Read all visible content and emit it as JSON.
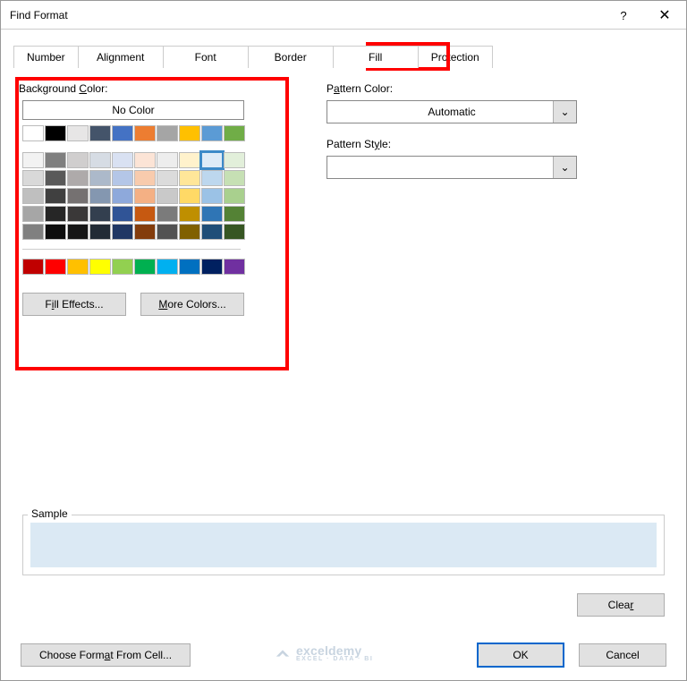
{
  "title": "Find Format",
  "help_glyph": "?",
  "close_glyph": "✕",
  "tabs": {
    "number": "Number",
    "alignment": "Alignment",
    "font": "Font",
    "border": "Border",
    "fill": "Fill",
    "protection": "Protection"
  },
  "left": {
    "bg_label_pre": "Background ",
    "bg_label_u": "C",
    "bg_label_post": "olor:",
    "no_color": "No Color",
    "fill_effects_u": "I",
    "fill_effects_pre": "Fill Effects...",
    "more_colors_u": "M",
    "more_colors_post": "ore Colors..."
  },
  "right": {
    "pattern_color_pre": "P",
    "pattern_color_u": "a",
    "pattern_color_post": "ttern Color:",
    "automatic": "Automatic",
    "pattern_style_pre": "Pattern St",
    "pattern_style_u": "y",
    "pattern_style_post": "le:"
  },
  "sample": "Sample",
  "clear_u": "R",
  "clear_post": "Clea",
  "choose_format_pre": "Choose Form",
  "choose_format_u": "a",
  "choose_format_post": "t From Cell...",
  "ok": "OK",
  "cancel": "Cancel",
  "watermark": "exceldemy",
  "watermark_sub": "EXCEL · DATA · BI",
  "dropdown_glyph": "⌄",
  "colors": {
    "theme_row": [
      "#ffffff",
      "#000000",
      "#e7e6e6",
      "#44546a",
      "#4472c4",
      "#ed7d31",
      "#a5a5a5",
      "#ffc000",
      "#5b9bd5",
      "#70ad47"
    ],
    "grid": [
      [
        "#f2f2f2",
        "#7f7f7f",
        "#d0cece",
        "#d6dce4",
        "#d9e1f2",
        "#fce4d6",
        "#ededed",
        "#fff2cc",
        "#ddebf7",
        "#e2efda"
      ],
      [
        "#d9d9d9",
        "#595959",
        "#aeaaaa",
        "#acb9ca",
        "#b4c6e7",
        "#f8cbad",
        "#dbdbdb",
        "#ffe699",
        "#bdd7ee",
        "#c6e0b4"
      ],
      [
        "#bfbfbf",
        "#404040",
        "#757171",
        "#8497b0",
        "#8ea9db",
        "#f4b084",
        "#c9c9c9",
        "#ffd966",
        "#9bc2e6",
        "#a9d08e"
      ],
      [
        "#a6a6a6",
        "#262626",
        "#3a3838",
        "#333f4f",
        "#305496",
        "#c65911",
        "#7b7b7b",
        "#bf8f00",
        "#2f75b5",
        "#548235"
      ],
      [
        "#808080",
        "#0d0d0d",
        "#161616",
        "#222b35",
        "#203764",
        "#833c0c",
        "#525252",
        "#806000",
        "#1f4e78",
        "#375623"
      ]
    ],
    "standard": [
      "#c00000",
      "#ff0000",
      "#ffc000",
      "#ffff00",
      "#92d050",
      "#00b050",
      "#00b0f0",
      "#0070c0",
      "#002060",
      "#7030a0"
    ],
    "selected": "#ddebf7"
  }
}
